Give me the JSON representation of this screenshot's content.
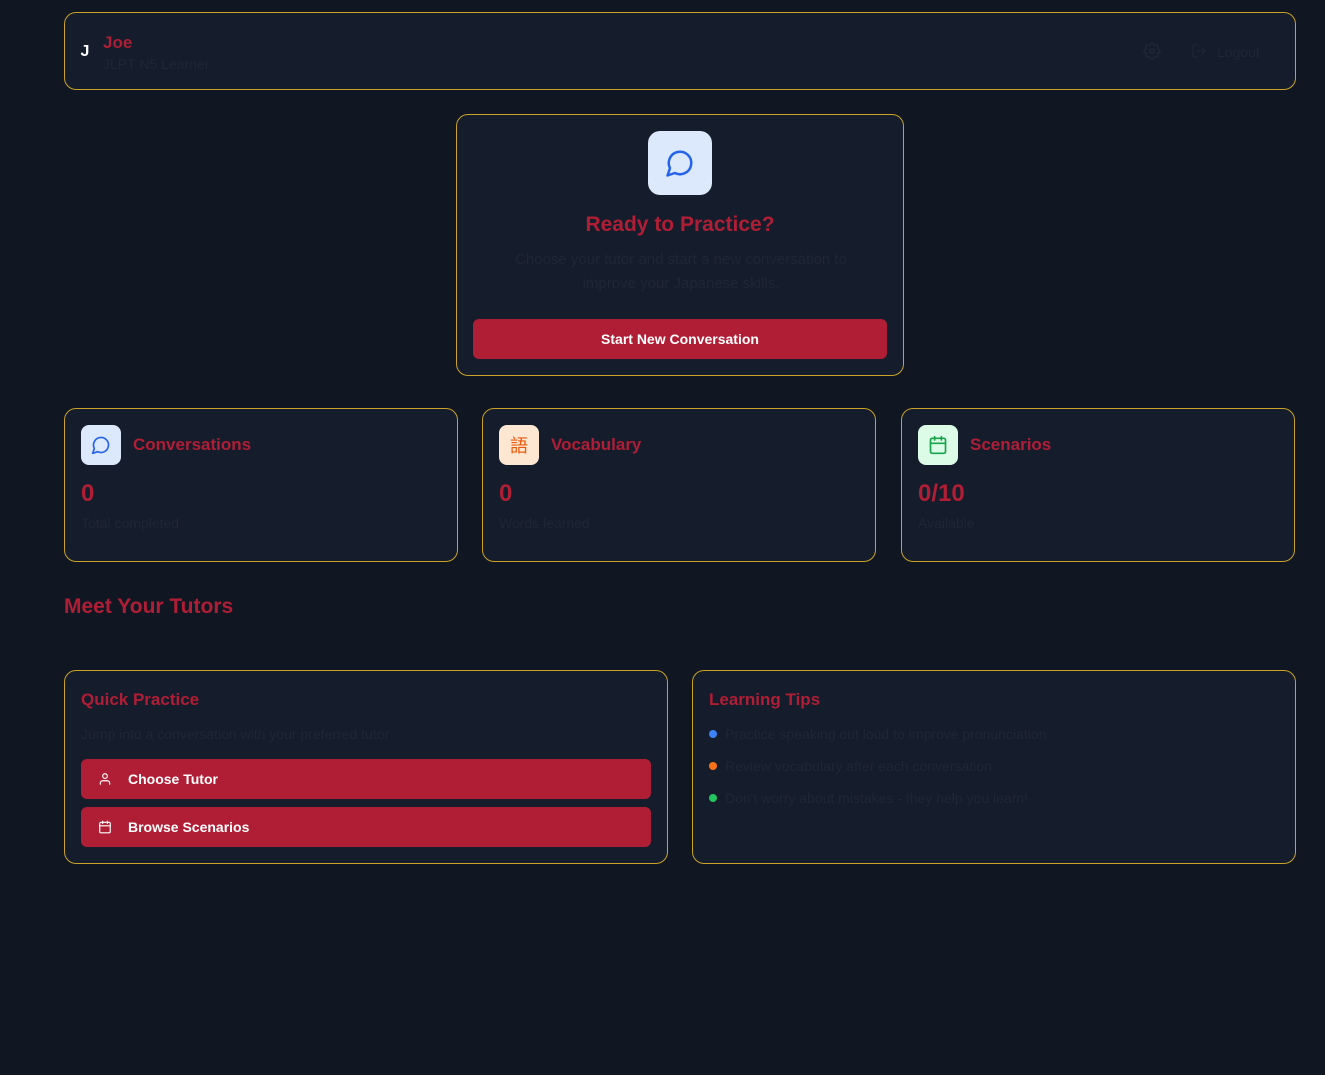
{
  "header": {
    "avatar_initial": "J",
    "user_name": "Joe",
    "user_level": "JLPT N5 Learner",
    "settings_icon": "gear-icon",
    "logout_label": "Logout",
    "logout_icon": "logout-icon"
  },
  "hero": {
    "icon": "message-circle-icon",
    "title": "Ready to Practice?",
    "description": "Choose your tutor and start a new conversation to improve your Japanese skills.",
    "button_label": "Start New Conversation"
  },
  "stats": [
    {
      "label": "Conversations",
      "value": "0",
      "sub": "Total completed",
      "icon": "message-circle-icon",
      "icon_bg": "#dce8fb",
      "icon_color": "#2563eb"
    },
    {
      "label": "Vocabulary",
      "value": "0",
      "sub": "Words learned",
      "icon_glyph": "語",
      "icon_bg": "#fde7d2",
      "icon_color": "#ea580c"
    },
    {
      "label": "Scenarios",
      "value": "0/10",
      "sub": "Available",
      "icon": "calendar-icon",
      "icon_bg": "#dcfce7",
      "icon_color": "#16a34a"
    }
  ],
  "tutors": {
    "heading": "Meet Your Tutors"
  },
  "quick_practice": {
    "title": "Quick Practice",
    "subtitle": "Jump into a conversation with your preferred tutor",
    "buttons": [
      {
        "label": "Choose Tutor",
        "icon": "user-icon"
      },
      {
        "label": "Browse Scenarios",
        "icon": "calendar-icon"
      }
    ]
  },
  "learning_tips": {
    "title": "Learning Tips",
    "tips": [
      {
        "text": "Practice speaking out loud to improve pronunciation",
        "color": "#3b82f6"
      },
      {
        "text": "Review vocabulary after each conversation",
        "color": "#f97316"
      },
      {
        "text": "Don't worry about mistakes - they help you learn!",
        "color": "#22c55e"
      }
    ]
  },
  "colors": {
    "accent": "#b01e35",
    "border": "#c9a227",
    "background": "#111722",
    "card": "#151c2b"
  }
}
